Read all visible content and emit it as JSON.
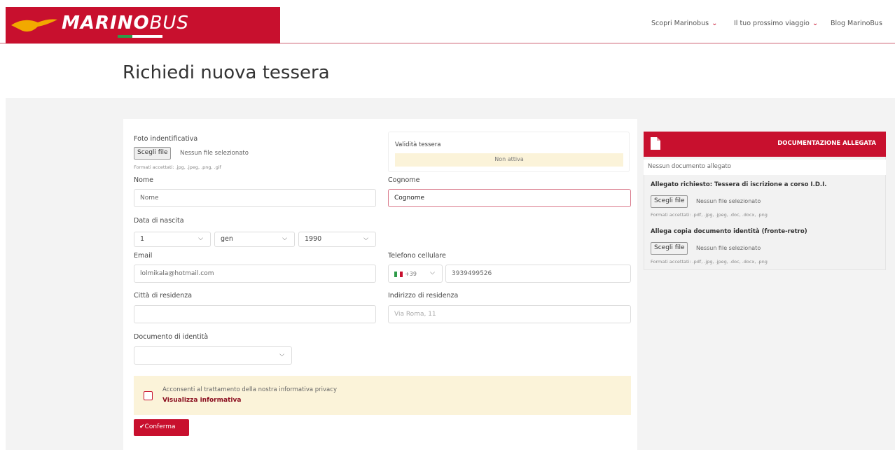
{
  "header": {
    "logo_main": "MARINO",
    "logo_sub": "BUS",
    "nav": [
      {
        "label": "Scopri Marinobus"
      },
      {
        "label": "Il tuo prossimo viaggio"
      },
      {
        "label": "Blog MarinoBus"
      }
    ]
  },
  "page_title": "Richiedi nuova tessera",
  "form": {
    "photo": {
      "label": "Foto indentificativa",
      "button": "Scegli file",
      "status": "Nessun file selezionato",
      "hint": "Formati accettati: .jpg, .jpeg, .png, .gif"
    },
    "validity": {
      "label": "Validità tessera",
      "status": "Non attiva"
    },
    "first_name": {
      "label": "Nome",
      "placeholder": "Nome"
    },
    "last_name": {
      "label": "Cognome",
      "value": "Cognome"
    },
    "birth_date": {
      "label": "Data di nascita",
      "day": "1",
      "month": "gen",
      "year": "1990"
    },
    "email": {
      "label": "Email",
      "value": "lolmikala@hotmail.com"
    },
    "phone": {
      "label": "Telefono cellulare",
      "prefix": "+39",
      "value": "3939499526"
    },
    "city": {
      "label": "Città di residenza",
      "value": ""
    },
    "address": {
      "label": "Indirizzo di residenza",
      "placeholder": "Via Roma, 11"
    },
    "id_document": {
      "label": "Documento di identità",
      "value": ""
    },
    "privacy": {
      "text": "Acconsenti al trattamento della nostra informativa privacy",
      "link": "Visualizza informativa"
    },
    "confirm_label": "✔Conferma"
  },
  "documents": {
    "title": "DOCUMENTAZIONE ALLEGATA",
    "empty": "Nessun documento allegato",
    "required_title": "Allegato richiesto: Tessera di iscrizione a corso I.D.I.",
    "identity_title": "Allega copia documento identità (fronte-retro)",
    "button": "Scegli file",
    "status": "Nessun file selezionato",
    "hint": "Formati accettati: .pdf, .jpg, .jpeg, .doc, .docx, .png"
  },
  "colors": {
    "brand": "#c8102e",
    "notice": "#fbf3d9"
  }
}
